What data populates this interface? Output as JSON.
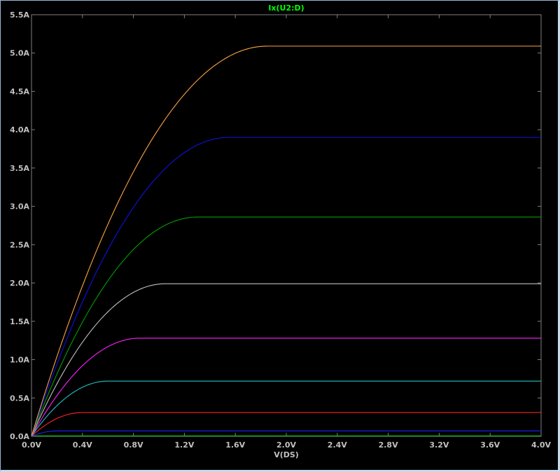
{
  "chart_data": {
    "type": "line",
    "title": "Ix(U2:D)",
    "title_color": "#00ff00",
    "xlabel": "V(DS)",
    "ylabel": "",
    "xlim": [
      0.0,
      4.0
    ],
    "ylim": [
      0.0,
      5.5
    ],
    "x_ticks": [
      0.0,
      0.4,
      0.8,
      1.2,
      1.6,
      2.0,
      2.4,
      2.8,
      3.2,
      3.6,
      4.0
    ],
    "x_tick_labels": [
      "0.0V",
      "0.4V",
      "0.8V",
      "1.2V",
      "1.6V",
      "2.0V",
      "2.4V",
      "2.8V",
      "3.2V",
      "3.6V",
      "4.0V"
    ],
    "y_ticks": [
      0.0,
      0.5,
      1.0,
      1.5,
      2.0,
      2.5,
      3.0,
      3.5,
      4.0,
      4.5,
      5.0,
      5.5
    ],
    "y_tick_labels": [
      "0.0A",
      "0.5A",
      "1.0A",
      "1.5A",
      "2.0A",
      "2.5A",
      "3.0A",
      "3.5A",
      "4.0A",
      "4.5A",
      "5.0A",
      "5.5A"
    ],
    "grid": false,
    "background": "#000000",
    "axis_color": "#808080",
    "series": [
      {
        "color": "#00c000",
        "vdsat": 0.05,
        "isat": 0.005
      },
      {
        "color": "#2020ff",
        "vdsat": 0.2,
        "isat": 0.07
      },
      {
        "color": "#ff2020",
        "vdsat": 0.4,
        "isat": 0.31
      },
      {
        "color": "#20c0c0",
        "vdsat": 0.6,
        "isat": 0.72
      },
      {
        "color": "#ff20ff",
        "vdsat": 0.85,
        "isat": 1.28
      },
      {
        "color": "#c0c0c0",
        "vdsat": 1.05,
        "isat": 1.99
      },
      {
        "color": "#00a000",
        "vdsat": 1.3,
        "isat": 2.86
      },
      {
        "color": "#1010e0",
        "vdsat": 1.55,
        "isat": 3.9
      },
      {
        "color": "#ffa040",
        "vdsat": 1.85,
        "isat": 5.09
      }
    ]
  }
}
